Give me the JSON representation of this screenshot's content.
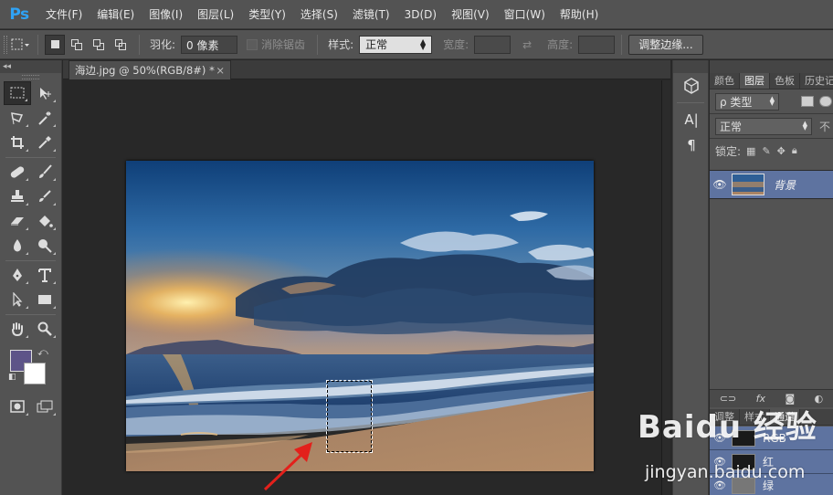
{
  "app": {
    "logo": "Ps"
  },
  "menu": [
    "文件(F)",
    "编辑(E)",
    "图像(I)",
    "图层(L)",
    "类型(Y)",
    "选择(S)",
    "滤镜(T)",
    "3D(D)",
    "视图(V)",
    "窗口(W)",
    "帮助(H)"
  ],
  "options": {
    "feather_label": "羽化:",
    "feather_value": "0 像素",
    "antialias_label": "消除锯齿",
    "style_label": "样式:",
    "style_value": "正常",
    "width_label": "宽度:",
    "height_label": "高度:",
    "refine_edge_label": "调整边缘..."
  },
  "document": {
    "tab_title": "海边.jpg @ 50%(RGB/8#) *",
    "tab_close": "×"
  },
  "right_mini": {
    "paragraph_glyph": "¶",
    "char_glyph": "A|"
  },
  "layers_panel": {
    "tabs": [
      "颜色",
      "图层",
      "色板",
      "历史记"
    ],
    "active_tab": "图层",
    "filter_kind": "ρ 类型",
    "blend_mode": "正常",
    "opacity_label": "不",
    "lock_label": "锁定:",
    "layer_name": "背景"
  },
  "channels_panel": {
    "tabs": [
      "调整",
      "样式",
      "通道"
    ],
    "active_tab": "通道",
    "rows": [
      {
        "label": "RGB"
      },
      {
        "label": "红"
      },
      {
        "label": "绿"
      }
    ]
  },
  "toolbox": {
    "foreground_color": "#5d5488",
    "background_color": "#ffffff"
  },
  "colors": {
    "accent": "#2fa3f6",
    "selection_blue": "#5e73a0"
  },
  "watermark": {
    "logo": "Baidu 经验",
    "url": "jingyan.baidu.com"
  }
}
